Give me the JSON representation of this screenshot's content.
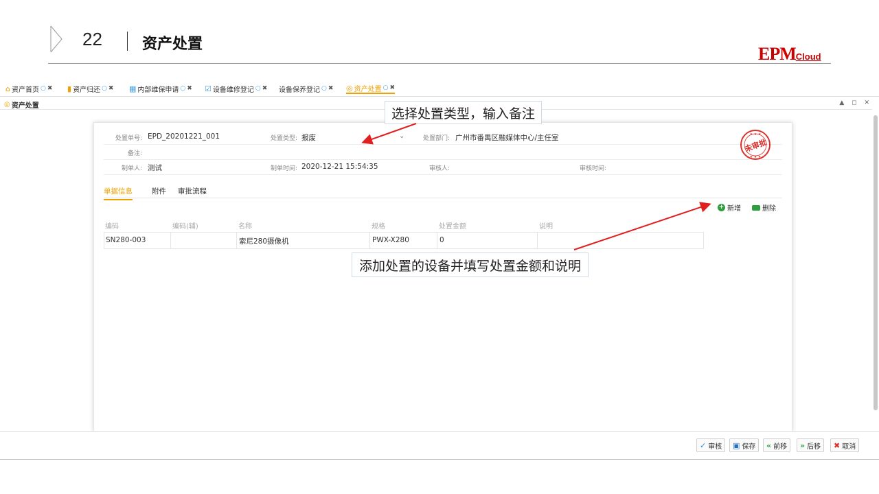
{
  "slide": {
    "number": "22",
    "title": "资产处置",
    "logo_main": "EPM",
    "logo_sub": "Cloud"
  },
  "tabs": [
    {
      "icon": "home-icon",
      "label": "资产首页",
      "active": false
    },
    {
      "icon": "return-icon",
      "label": "资产归还",
      "active": false
    },
    {
      "icon": "grid-icon",
      "label": "内部维保申请",
      "active": false
    },
    {
      "icon": "edit-icon",
      "label": "设备维修登记",
      "active": false
    },
    {
      "icon": "none",
      "label": "设备保养登记",
      "active": false
    },
    {
      "icon": "dispose-icon",
      "label": "资产处置",
      "active": true
    }
  ],
  "panel": {
    "title": "资产处置",
    "controls": "▲ ◻ ✕"
  },
  "form": {
    "doc_no_label": "处置单号:",
    "doc_no": "EPD_20201221_001",
    "type_label": "处置类型:",
    "type_value": "报废",
    "dept_label": "处置部门:",
    "dept_value": "广州市番禺区融媒体中心/主任室",
    "remark_label": "备注:",
    "remark_value": "",
    "creator_label": "制单人:",
    "creator_value": "测试",
    "created_time_label": "制单时间:",
    "created_time_value": "2020-12-21 15:54:35",
    "auditor_label": "审核人:",
    "auditor_value": "",
    "audit_time_label": "审核时间:",
    "audit_time_value": "",
    "stamp_text": "未审批"
  },
  "subtabs": [
    "单据信息",
    "附件",
    "审批流程"
  ],
  "toolbar": {
    "add_label": "新增",
    "delete_label": "删除"
  },
  "grid": {
    "columns": [
      "编码",
      "编码(辅)",
      "名称",
      "规格",
      "处置金额",
      "说明"
    ],
    "rows": [
      [
        "SN280-003",
        "",
        "索尼280摄像机",
        "PWX-X280",
        "0",
        ""
      ]
    ]
  },
  "bottom_buttons": [
    {
      "icon": "check-circle-icon",
      "label": "审核",
      "color": "#3a8fd6"
    },
    {
      "icon": "save-icon",
      "label": "保存",
      "color": "#2a6fbd"
    },
    {
      "icon": "prev-icon",
      "label": "前移",
      "color": "#2e9e3e"
    },
    {
      "icon": "next-icon",
      "label": "后移",
      "color": "#2e9e3e"
    },
    {
      "icon": "cancel-icon",
      "label": "取消",
      "color": "#d9302c"
    }
  ],
  "callouts": {
    "top": "选择处置类型，输入备注",
    "bottom": "添加处置的设备并填写处置金额和说明"
  },
  "colors": {
    "accent": "#f0a000",
    "arrow": "#e02020",
    "brand": "#cc0000"
  }
}
